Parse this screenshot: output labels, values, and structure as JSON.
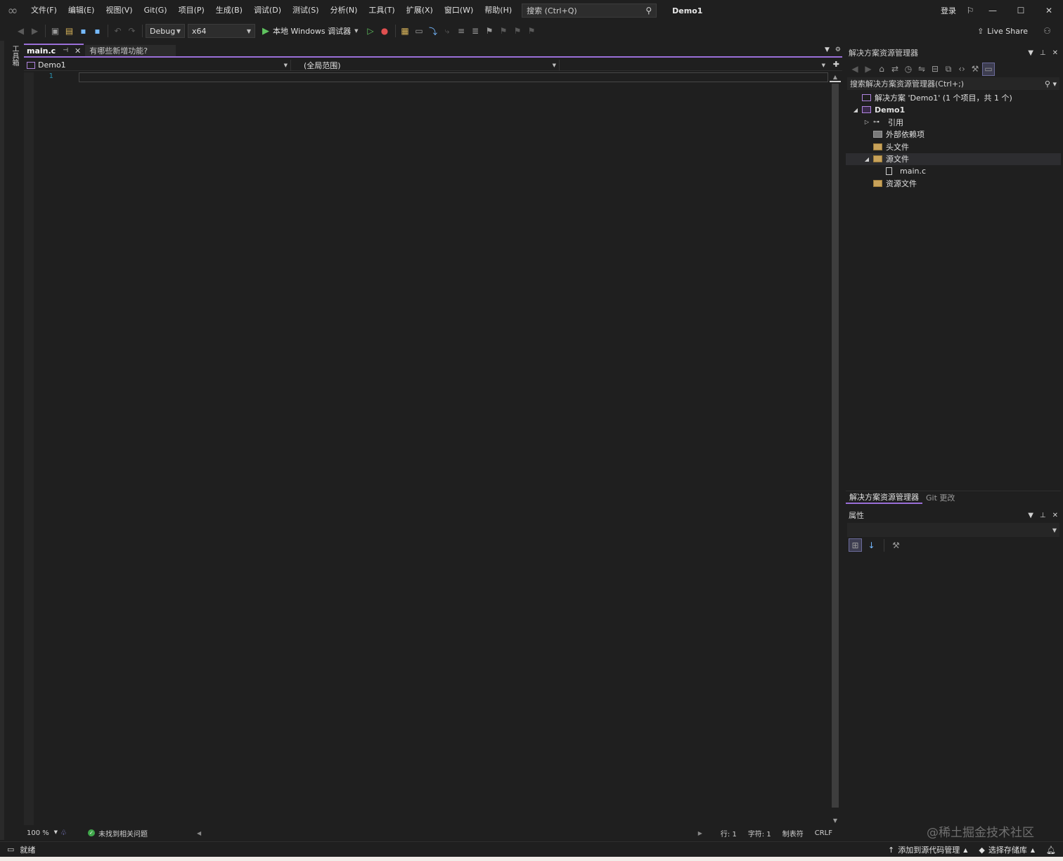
{
  "titlebar": {
    "menus": [
      "文件(F)",
      "编辑(E)",
      "视图(V)",
      "Git(G)",
      "项目(P)",
      "生成(B)",
      "调试(D)",
      "测试(S)",
      "分析(N)",
      "工具(T)",
      "扩展(X)",
      "窗口(W)",
      "帮助(H)"
    ],
    "search_placeholder": "搜索 (Ctrl+Q)",
    "solution_name": "Demo1",
    "login": "登录"
  },
  "toolbar": {
    "config": "Debug",
    "platform": "x64",
    "run_label": "本地 Windows 调试器",
    "live_share": "Live Share"
  },
  "left_strip": {
    "tab_label": "工具箱"
  },
  "editor": {
    "tabs": {
      "active": "main.c",
      "other": "有哪些新增功能?"
    },
    "nav": {
      "project": "Demo1",
      "scope": "(全局范围)"
    },
    "line_number": "1",
    "status": {
      "zoom": "100 %",
      "issues": "未找到相关问题",
      "line": "行: 1",
      "char": "字符: 1",
      "tabs": "制表符",
      "eol": "CRLF"
    }
  },
  "solution_explorer": {
    "title": "解决方案资源管理器",
    "search_placeholder": "搜索解决方案资源管理器(Ctrl+;)",
    "tree": [
      {
        "label": "解决方案 'Demo1' (1 个项目，共 1 个)",
        "level": 0,
        "icon": "solution-icon",
        "expander": ""
      },
      {
        "label": "Demo1",
        "level": 0,
        "icon": "project-icon",
        "expander": "expanded",
        "bold": true
      },
      {
        "label": "引用",
        "level": 1,
        "icon": "references-icon",
        "expander": "collapsed"
      },
      {
        "label": "外部依赖项",
        "level": 1,
        "icon": "external-deps-icon",
        "expander": ""
      },
      {
        "label": "头文件",
        "level": 1,
        "icon": "folder-icon",
        "expander": ""
      },
      {
        "label": "源文件",
        "level": 1,
        "icon": "folder-icon",
        "expander": "expanded",
        "selected": true
      },
      {
        "label": "main.c",
        "level": 2,
        "icon": "c-file-icon",
        "expander": ""
      },
      {
        "label": "资源文件",
        "level": 1,
        "icon": "folder-icon",
        "expander": ""
      }
    ],
    "bottom_tabs": [
      "解决方案资源管理器",
      "Git 更改"
    ]
  },
  "properties": {
    "title": "属性"
  },
  "statusbar": {
    "ready": "就绪",
    "add_source_control": "添加到源代码管理",
    "select_repo": "选择存储库"
  },
  "watermark": "@稀土掘金技术社区"
}
